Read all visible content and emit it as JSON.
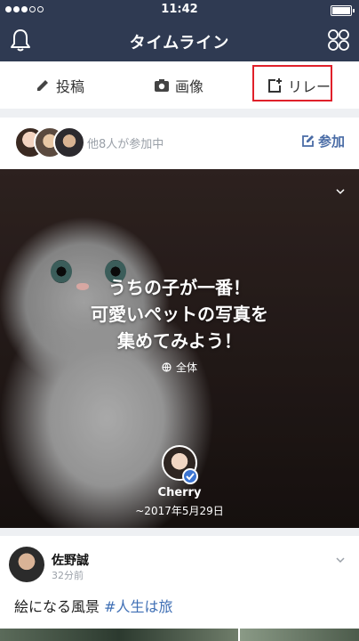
{
  "status_bar": {
    "time": "11:42"
  },
  "nav": {
    "title": "タイムライン"
  },
  "actions": {
    "post": "投稿",
    "image": "画像",
    "relay": "リレー"
  },
  "participants": {
    "text": "他8人が参加中",
    "join": "参加"
  },
  "hero": {
    "title_lines": [
      "うちの子が一番！",
      "可愛いペットの写真を",
      "集めてみよう！"
    ],
    "scope": "全体",
    "author": "Cherry",
    "date": "~2017年5月29日"
  },
  "post": {
    "name": "佐野誠",
    "time": "32分前",
    "text": "絵になる風景",
    "hashtag": "#人生は旅"
  },
  "colors": {
    "header": "#2f3a52",
    "accent": "#4a6ca6",
    "highlight": "#e0202a"
  },
  "icons": [
    "bell-icon",
    "apps-grid-icon",
    "pencil-icon",
    "camera-icon",
    "relay-add-icon",
    "edit-icon",
    "globe-icon",
    "chevron-down-icon",
    "verified-check-icon"
  ]
}
